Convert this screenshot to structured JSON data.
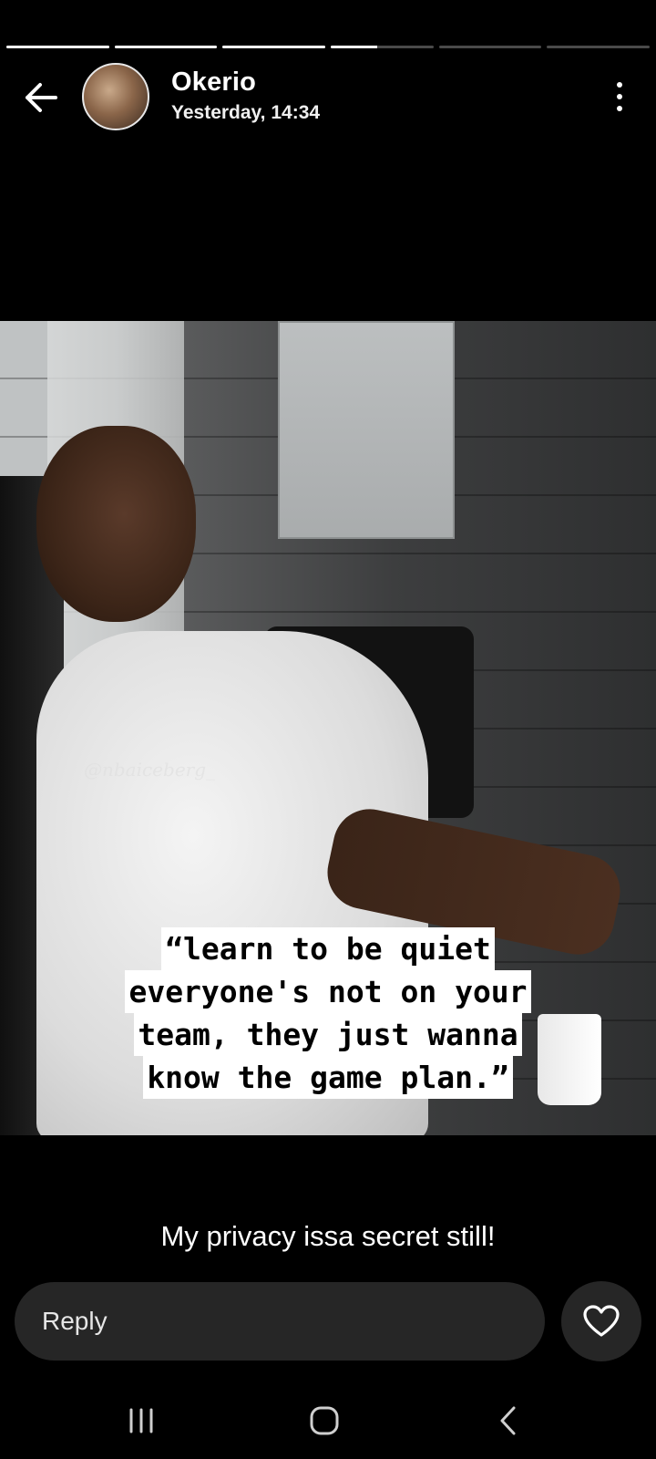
{
  "story": {
    "progress": [
      1,
      1,
      1,
      0.45,
      0,
      0
    ]
  },
  "header": {
    "user_name": "Okerio",
    "timestamp": "Yesterday, 14:34",
    "back_icon": "arrow-left-icon",
    "more_icon": "more-vertical-icon"
  },
  "media": {
    "watermark": "@nbaiceberg_",
    "quote_lines": [
      "“learn to be quiet",
      "everyone's not on your",
      "team, they just wanna",
      "know the game plan.”"
    ]
  },
  "caption": "My privacy issa secret still!",
  "reply": {
    "placeholder": "Reply",
    "like_icon": "heart-icon"
  },
  "system_nav": {
    "recents_icon": "recents-icon",
    "home_icon": "home-icon",
    "back_icon": "back-chevron-icon"
  },
  "colors": {
    "background": "#000000",
    "reply_bg": "#262626",
    "progress_active": "#ffffff",
    "progress_inactive": "#4a4a4a"
  }
}
